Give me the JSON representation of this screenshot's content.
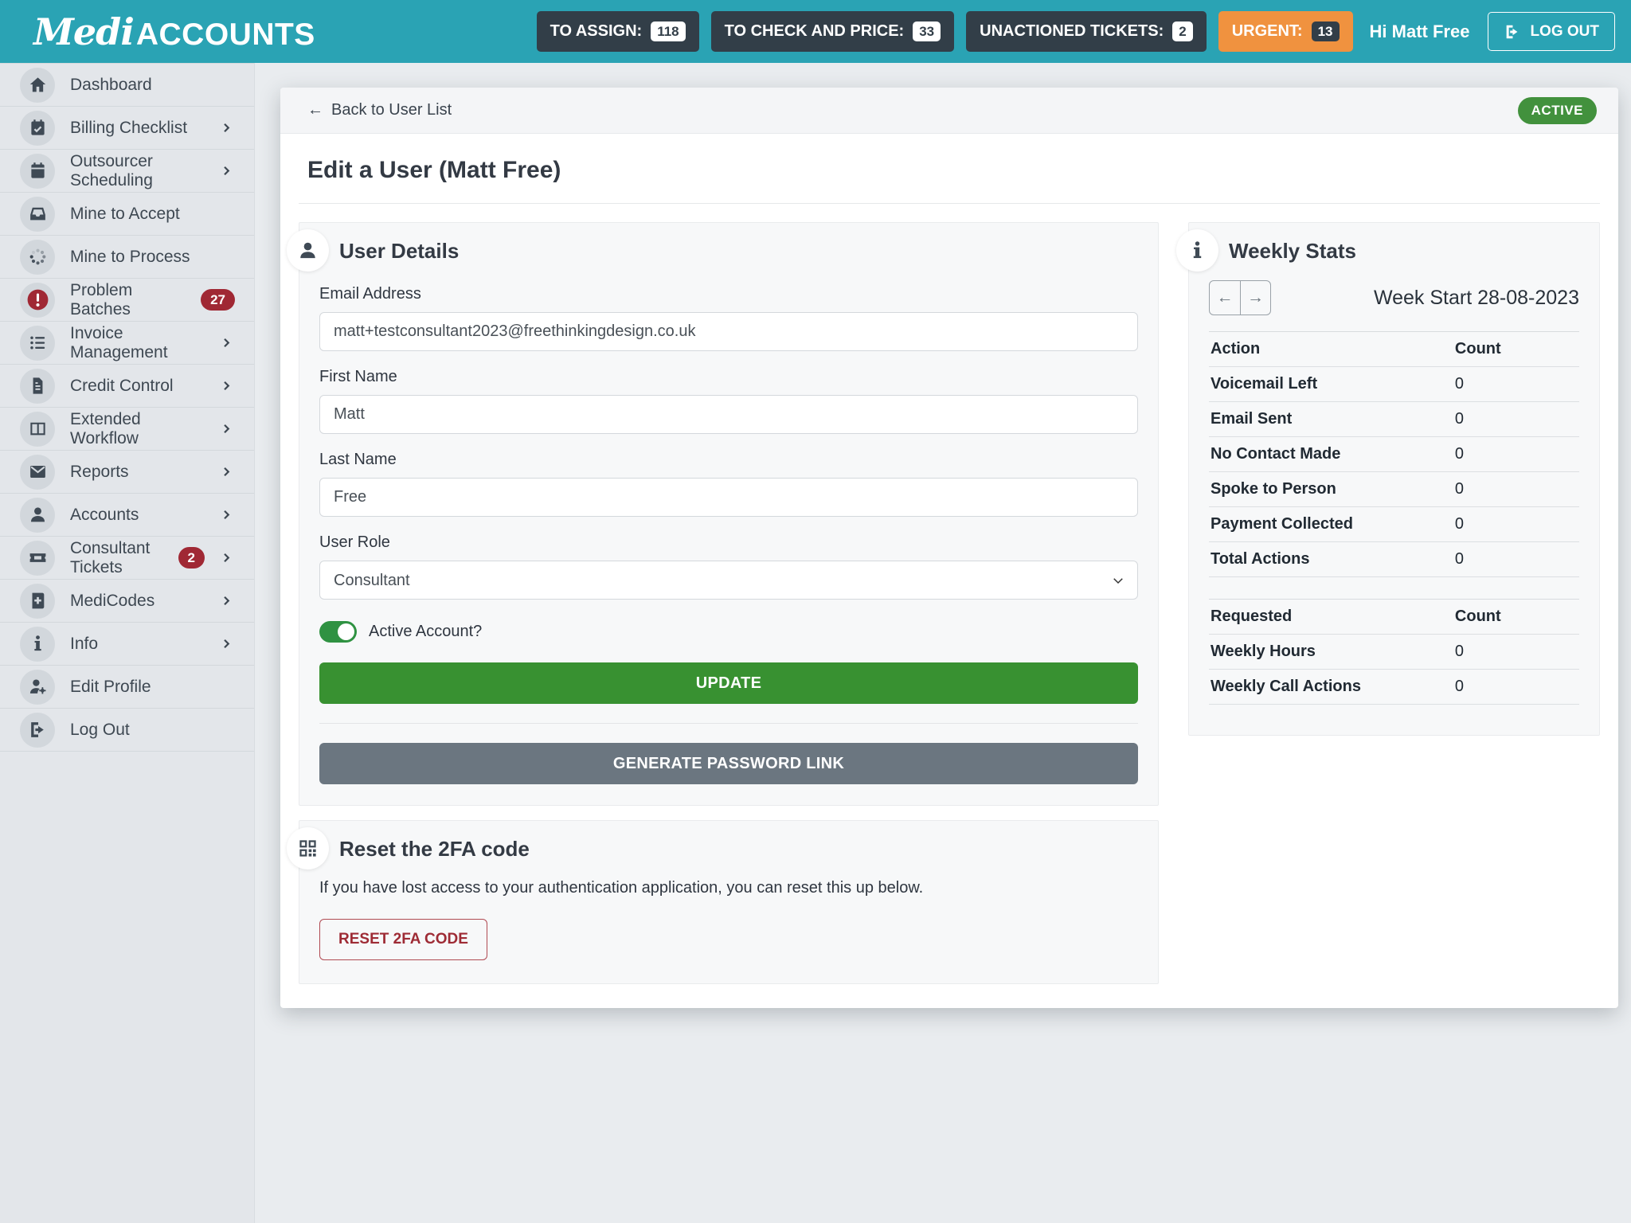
{
  "brand": {
    "medi": "Medi",
    "accounts": "ACCOUNTS"
  },
  "header": {
    "counters": [
      {
        "label": "TO ASSIGN:",
        "count": "118",
        "style": "dark"
      },
      {
        "label": "TO CHECK AND PRICE:",
        "count": "33",
        "style": "dark"
      },
      {
        "label": "UNACTIONED TICKETS:",
        "count": "2",
        "style": "dark"
      },
      {
        "label": "URGENT:",
        "count": "13",
        "style": "orange"
      }
    ],
    "greeting": "Hi Matt Free",
    "logout_label": "LOG OUT"
  },
  "sidebar": {
    "items": [
      {
        "label": "Dashboard",
        "icon": "home"
      },
      {
        "label": "Billing Checklist",
        "icon": "calendar-check",
        "chevron": true
      },
      {
        "label": "Outsourcer Scheduling",
        "icon": "calendar",
        "chevron": true
      },
      {
        "label": "Mine to Accept",
        "icon": "inbox"
      },
      {
        "label": "Mine to Process",
        "icon": "spinner"
      },
      {
        "label": "Problem Batches",
        "icon": "alert-circle",
        "icon_color": "red",
        "badge": "27"
      },
      {
        "label": "Invoice Management",
        "icon": "list",
        "chevron": true
      },
      {
        "label": "Credit Control",
        "icon": "file",
        "chevron": true
      },
      {
        "label": "Extended Workflow",
        "icon": "columns",
        "chevron": true
      },
      {
        "label": "Reports",
        "icon": "envelope",
        "chevron": true
      },
      {
        "label": "Accounts",
        "icon": "user",
        "chevron": true
      },
      {
        "label": "Consultant Tickets",
        "icon": "ticket",
        "badge": "2",
        "chevron": true
      },
      {
        "label": "MediCodes",
        "icon": "book-medical",
        "chevron": true
      },
      {
        "label": "Info",
        "icon": "info",
        "chevron": true
      },
      {
        "label": "Edit Profile",
        "icon": "user-gear"
      },
      {
        "label": "Log Out",
        "icon": "sign-out"
      }
    ]
  },
  "page": {
    "back_arrow": "←",
    "back_label": "Back to User List",
    "status_badge": "ACTIVE",
    "title": "Edit a User (Matt Free)"
  },
  "user_details": {
    "title": "User Details",
    "fields": {
      "email": {
        "label": "Email Address",
        "value": "matt+testconsultant2023@freethinkingdesign.co.uk"
      },
      "first_name": {
        "label": "First Name",
        "value": "Matt"
      },
      "last_name": {
        "label": "Last Name",
        "value": "Free"
      },
      "role": {
        "label": "User Role",
        "value": "Consultant"
      }
    },
    "active_toggle_label": "Active Account?",
    "active_toggle_state": "on",
    "update_button": "UPDATE",
    "generate_button": "GENERATE PASSWORD LINK"
  },
  "weekly_stats": {
    "title": "Weekly Stats",
    "prev_arrow": "←",
    "next_arrow": "→",
    "week_label": "Week Start 28-08-2023",
    "actions_table": {
      "headers": [
        "Action",
        "Count"
      ],
      "rows": [
        [
          "Voicemail Left",
          "0"
        ],
        [
          "Email Sent",
          "0"
        ],
        [
          "No Contact Made",
          "0"
        ],
        [
          "Spoke to Person",
          "0"
        ],
        [
          "Payment Collected",
          "0"
        ],
        [
          "Total Actions",
          "0"
        ]
      ]
    },
    "requested_table": {
      "headers": [
        "Requested",
        "Count"
      ],
      "rows": [
        [
          "Weekly Hours",
          "0"
        ],
        [
          "Weekly Call Actions",
          "0"
        ]
      ]
    }
  },
  "twofa": {
    "title": "Reset the 2FA code",
    "description": "If you have lost access to your authentication application, you can reset this up below.",
    "button": "RESET 2FA CODE"
  },
  "colors": {
    "header_teal": "#2aa3b4",
    "dark_button": "#323e48",
    "urgent_orange": "#f0923f",
    "badge_red": "#a02834",
    "active_green": "#42913d",
    "update_green": "#389131",
    "toggle_green": "#2f9242",
    "generate_gray": "#6b7680",
    "danger_red": "#9e2b35",
    "sidebar_bg": "#e3e6ea",
    "panel_bg": "#f7f8f9"
  }
}
